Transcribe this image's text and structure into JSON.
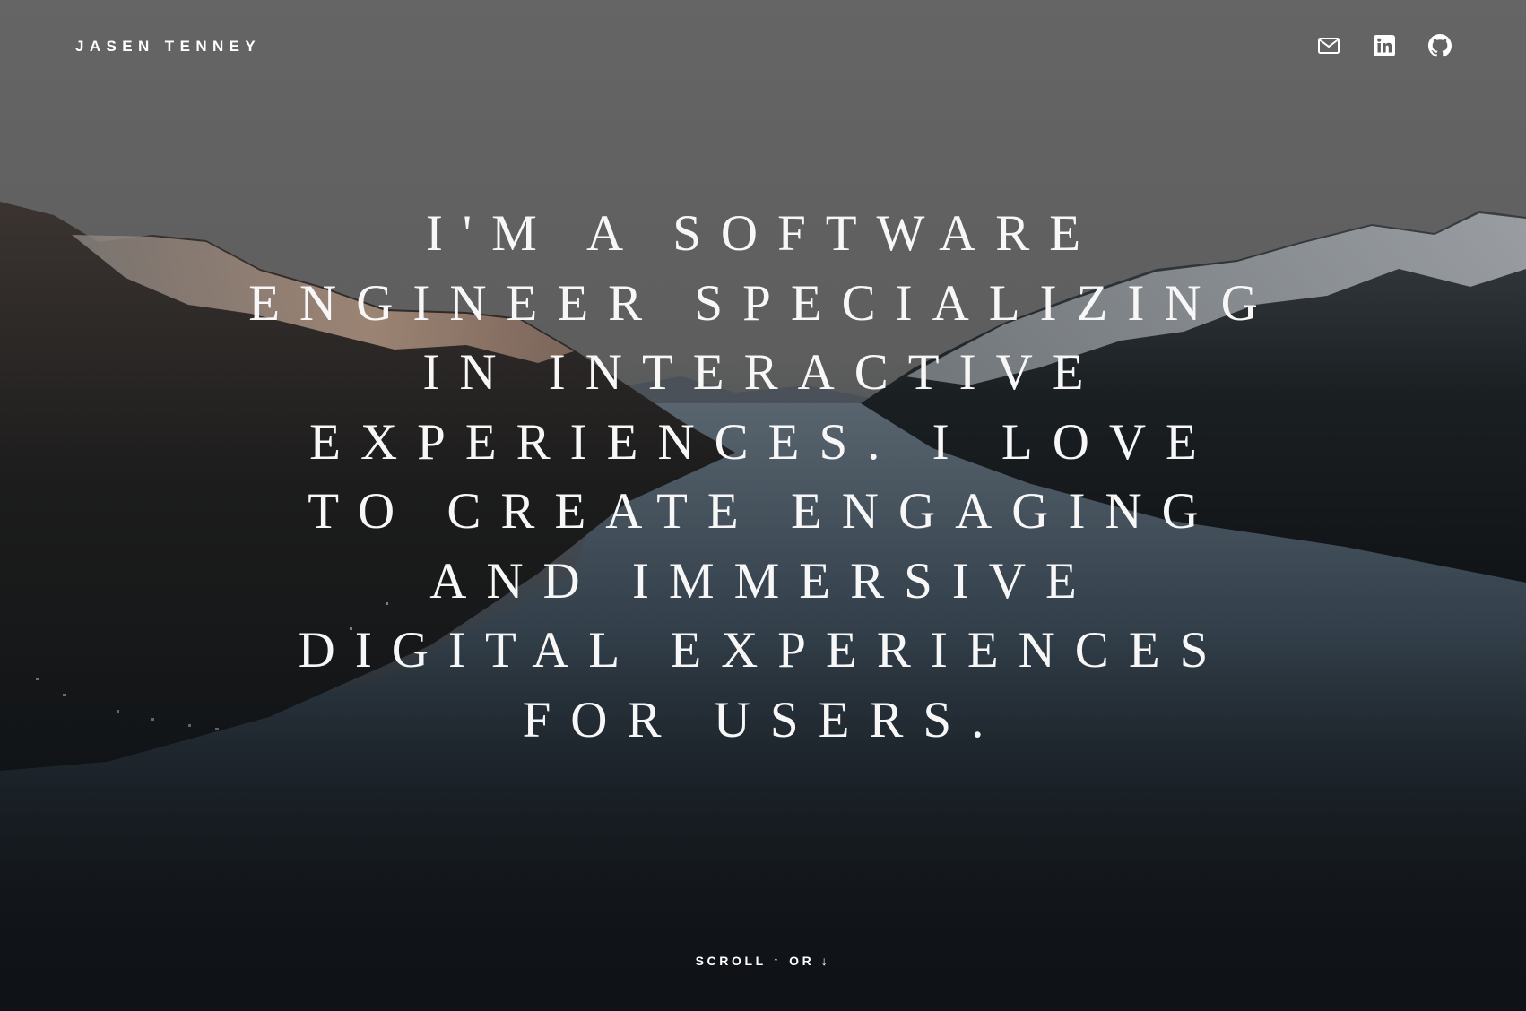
{
  "header": {
    "logo_text": "JASEN TENNEY",
    "social_links": [
      {
        "name": "email",
        "icon": "mail-icon"
      },
      {
        "name": "linkedin",
        "icon": "linkedin-icon"
      },
      {
        "name": "github",
        "icon": "github-icon"
      }
    ]
  },
  "hero": {
    "headline": "I'm a software engineer specializing in interactive experiences. I love to create engaging and immersive digital experiences for users.",
    "background": "dark-fjord-mountain-landscape"
  },
  "footer": {
    "scroll_hint": "SCROLL ↑ OR ↓"
  },
  "colors": {
    "text": "#ffffff",
    "sky": "#656565",
    "water": "#2f3b47",
    "bottom": "#0f1216"
  }
}
